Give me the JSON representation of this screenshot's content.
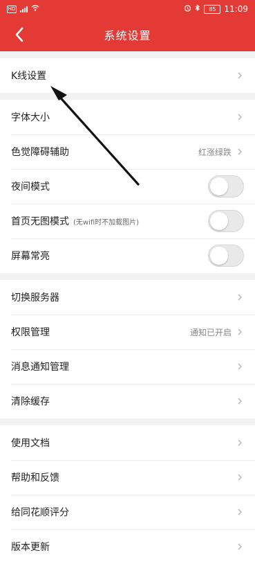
{
  "status": {
    "time": "11:09",
    "battery": "85",
    "left_box": "HD"
  },
  "header": {
    "title": "系统设置"
  },
  "sections": [
    {
      "items": [
        {
          "label": "K线设置",
          "type": "chevron"
        }
      ]
    },
    {
      "items": [
        {
          "label": "字体大小",
          "type": "chevron"
        },
        {
          "label": "色觉障碍辅助",
          "type": "chevron",
          "value": "红涨绿跌"
        },
        {
          "label": "夜间模式",
          "type": "toggle",
          "state": "off"
        },
        {
          "label": "首页无图模式",
          "sub": "(无wifi时不加载图片)",
          "type": "toggle",
          "state": "off"
        },
        {
          "label": "屏幕常亮",
          "type": "toggle",
          "state": "off"
        }
      ]
    },
    {
      "items": [
        {
          "label": "切换服务器",
          "type": "chevron"
        },
        {
          "label": "权限管理",
          "type": "chevron",
          "value": "通知已开启"
        },
        {
          "label": "消息通知管理",
          "type": "chevron"
        },
        {
          "label": "清除缓存",
          "type": "chevron"
        }
      ]
    },
    {
      "items": [
        {
          "label": "使用文档",
          "type": "chevron"
        },
        {
          "label": "帮助和反馈",
          "type": "chevron"
        },
        {
          "label": "给同花顺评分",
          "type": "chevron"
        },
        {
          "label": "版本更新",
          "type": "chevron"
        }
      ]
    }
  ],
  "colors": {
    "header": "#e33a35",
    "background": "#f2f2f2",
    "toggle_off": "#e9e9e9"
  }
}
